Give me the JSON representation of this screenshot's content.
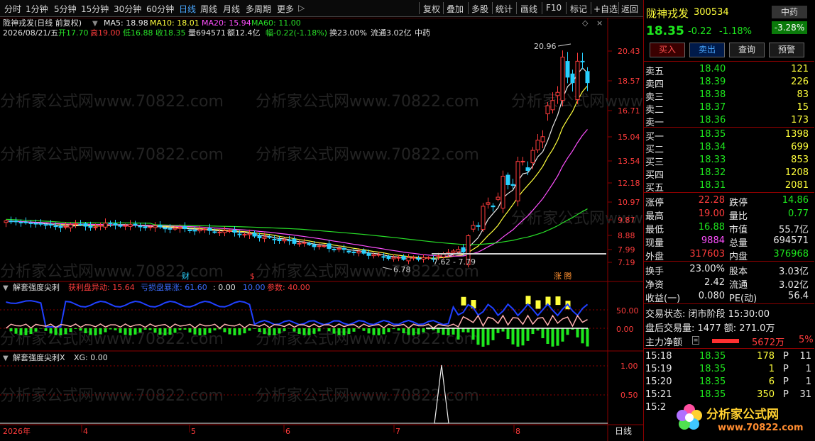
{
  "toolbar": {
    "periods": [
      "分时",
      "1分钟",
      "5分钟",
      "15分钟",
      "30分钟",
      "60分钟",
      "日线",
      "周线",
      "月线",
      "多周期",
      "更多"
    ],
    "active_period": "日线",
    "tools": [
      "复权",
      "叠加",
      "多股",
      "统计",
      "画线",
      "F10",
      "标记",
      "+自选",
      "返回"
    ]
  },
  "chart": {
    "title": "陇神戎发(日线 前复权)",
    "ma": {
      "ma5": "MA5: 18.98",
      "ma10": "MA10: 18.01",
      "ma20": "MA20: 15.94",
      "ma60": "MA60: 11.00"
    },
    "info_date": "2026/08/21/五",
    "info_open": "开17.70",
    "info_high": "高19.00",
    "info_low": "低16.88",
    "info_close": "收18.35",
    "info_vol": "量694571",
    "info_amount": "额12.4亿",
    "info_change": "幅-0.22(-1.18%)",
    "info_turnover": "换23.00%",
    "info_float": "流通3.02亿",
    "info_industry": "中药",
    "price_labels": [
      "20.43",
      "18.57",
      "16.71",
      "15.04",
      "13.54",
      "12.18",
      "10.97",
      "9.87",
      "8.88",
      "7.99",
      "7.19"
    ],
    "high_mark": "20.96",
    "low_mark": "6.78",
    "range_mark": "7.62 - 7.79",
    "event_cai": "财",
    "event_dollar": "$",
    "event_zhangting": "涨 腾",
    "watermark": "分析家公式网www.70822.com",
    "x_labels": [
      "2026年",
      "4",
      "5",
      "6",
      "7",
      "8"
    ],
    "period_tag": "日线",
    "ind1_name": "解套强度尖刺",
    "ind1_profit": "获利盘异动: 15.64",
    "ind1_loss": "亏损盘暴涨: 61.60",
    "ind1_zero": ": 0.00",
    "ind1_ten": "10.00",
    "ind1_param": "参数: 40.00",
    "ind1_labels": [
      "50.00",
      "0.00"
    ],
    "ind2_name": "解套强度尖刺X",
    "ind2_xg": "XG: 0.00",
    "ind2_labels": [
      "1.00",
      "0.50"
    ]
  },
  "quote": {
    "name": "陇神戎发",
    "code": "300534",
    "sector": "中药",
    "sector_change": "-3.28%",
    "price": "18.35",
    "change": "-0.22",
    "change_pct": "-1.18%",
    "buttons": [
      "买入",
      "卖出",
      "查询",
      "预警"
    ],
    "asks": [
      {
        "label": "卖五",
        "price": "18.40",
        "vol": "121"
      },
      {
        "label": "卖四",
        "price": "18.39",
        "vol": "226"
      },
      {
        "label": "卖三",
        "price": "18.38",
        "vol": "83"
      },
      {
        "label": "卖二",
        "price": "18.37",
        "vol": "15"
      },
      {
        "label": "卖一",
        "price": "18.36",
        "vol": "173"
      }
    ],
    "bids": [
      {
        "label": "买一",
        "price": "18.35",
        "vol": "1398"
      },
      {
        "label": "买二",
        "price": "18.34",
        "vol": "699"
      },
      {
        "label": "买三",
        "price": "18.33",
        "vol": "853"
      },
      {
        "label": "买四",
        "price": "18.32",
        "vol": "1208"
      },
      {
        "label": "买五",
        "price": "18.31",
        "vol": "2081"
      }
    ],
    "stats": [
      {
        "l1": "涨停",
        "v1": "22.28",
        "c1": "red",
        "l2": "跌停",
        "v2": "14.86",
        "c2": "green"
      },
      {
        "l1": "最高",
        "v1": "19.00",
        "c1": "red",
        "l2": "量比",
        "v2": "0.77",
        "c2": "green"
      },
      {
        "l1": "最低",
        "v1": "16.88",
        "c1": "green",
        "l2": "市值",
        "v2": "55.7亿",
        "c2": "white"
      },
      {
        "l1": "现量",
        "v1": "9884",
        "c1": "magenta",
        "l2": "总量",
        "v2": "694571",
        "c2": "white"
      },
      {
        "l1": "外盘",
        "v1": "317603",
        "c1": "red",
        "l2": "内盘",
        "v2": "376968",
        "c2": "green"
      }
    ],
    "stats2": [
      {
        "l1": "换手",
        "v1": "23.00%",
        "l2": "股本",
        "v2": "3.03亿"
      },
      {
        "l1": "净资",
        "v1": "2.42",
        "l2": "流通",
        "v2": "3.02亿"
      },
      {
        "l1": "收益(一)",
        "v1": "0.080",
        "l2": "PE(动)",
        "v2": "56.4"
      }
    ],
    "trade_status": "交易状态: 闭市阶段 15:30:00",
    "after_hours": "盘后交易量: 1477  额: 271.0万",
    "net_amount_label": "主力净额",
    "net_amount": "5672万",
    "net_pct": "5%",
    "ticks": [
      {
        "time": "15:18",
        "price": "18.35",
        "vol": "178",
        "flag": "P",
        "n": "11"
      },
      {
        "time": "15:19",
        "price": "18.35",
        "vol": "1",
        "flag": "P",
        "n": "1"
      },
      {
        "time": "15:20",
        "price": "18.35",
        "vol": "6",
        "flag": "P",
        "n": "1"
      },
      {
        "time": "15:21",
        "price": "18.35",
        "vol": "350",
        "flag": "P",
        "n": "31"
      },
      {
        "time": "15:2",
        "price": "",
        "vol": "",
        "flag": "",
        "n": ""
      }
    ],
    "logo_text": "分析家公式网",
    "logo_url": "www.70822.com"
  },
  "colors": {
    "up": "#ff3c3c",
    "down": "#28d0ff",
    "ma5": "#e8e8e8",
    "ma10": "#ffff3c",
    "ma20": "#ff50ff",
    "ma60": "#28e028",
    "border": "#8b0000"
  }
}
